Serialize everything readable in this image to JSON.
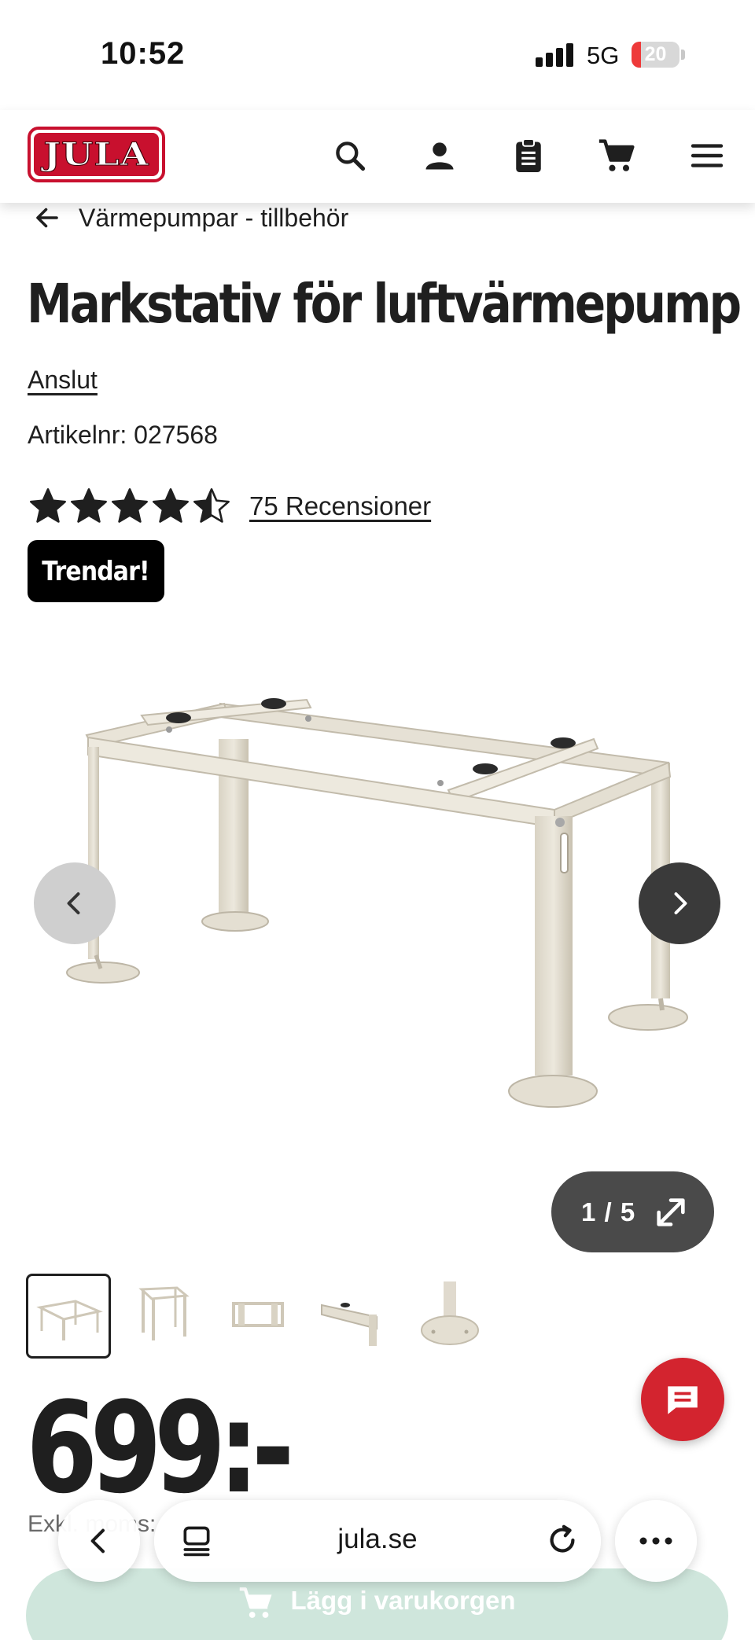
{
  "status_bar": {
    "time": "10:52",
    "network": "5G",
    "battery": "20",
    "battery_level": 0.2
  },
  "header": {
    "logo_text": "JULA",
    "icons": [
      "search-icon",
      "user-icon",
      "clipboard-icon",
      "cart-icon",
      "menu-icon"
    ]
  },
  "breadcrumb": {
    "label": "Värmepumpar - tillbehör"
  },
  "product": {
    "title": "Markstativ för luftvärmepump",
    "brand": "Anslut",
    "article_label": "Artikelnr:",
    "article_number": "027568",
    "rating": 4.5,
    "rating_max": 5,
    "reviews": "75 Recensioner",
    "badge": "Trendar!",
    "price": "699:-",
    "vat_note": "Exkl. moms:"
  },
  "gallery": {
    "counter": "1 / 5",
    "current": 1,
    "total": 5
  },
  "cart": {
    "button_label": "Lägg i varukorgen"
  },
  "browser": {
    "url": "jula.se"
  },
  "colors": {
    "brand_red": "#c8102e",
    "cart_green": "#cfe6dc",
    "badge_black": "#000000",
    "chat_red": "#d3242f"
  }
}
